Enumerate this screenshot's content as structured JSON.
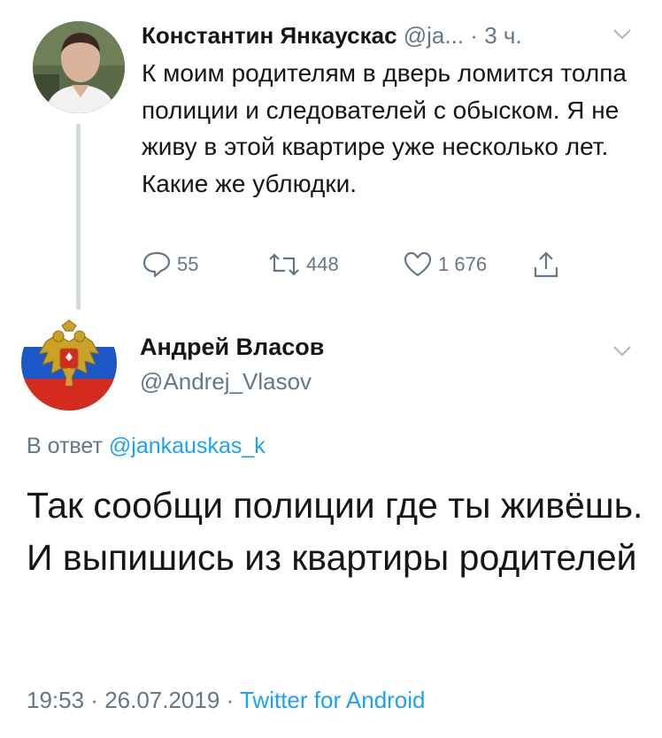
{
  "parent_tweet": {
    "author_name": "Константин Янкаускас",
    "author_handle": "@ja...",
    "separator": " · ",
    "time_ago": "3 ч.",
    "text": "К моим родителям в дверь ломится толпа полиции и следователей с обыском. Я не живу в этой квартире уже несколько лет. Какие же ублюдки.",
    "actions": {
      "replies": "55",
      "retweets": "448",
      "likes": "1 676"
    },
    "icons": [
      "reply-icon",
      "retweet-icon",
      "like-icon",
      "share-icon",
      "chevron-down-icon"
    ]
  },
  "reply_tweet": {
    "author_name": "Андрей Власов",
    "author_handle": "@Andrej_Vlasov",
    "reply_prefix": "В ответ ",
    "reply_to_handle": "@jankauskas_k",
    "text": "Так сообщи полиции где ты живёшь. И выпишись из квартиры родителей",
    "time": "19:53",
    "date": "26.07.2019",
    "separator": " · ",
    "source": "Twitter for Android"
  },
  "colors": {
    "text_primary": "#14171a",
    "text_secondary": "#657786",
    "link": "#1da1f2",
    "thread_line": "#cfd9de"
  }
}
